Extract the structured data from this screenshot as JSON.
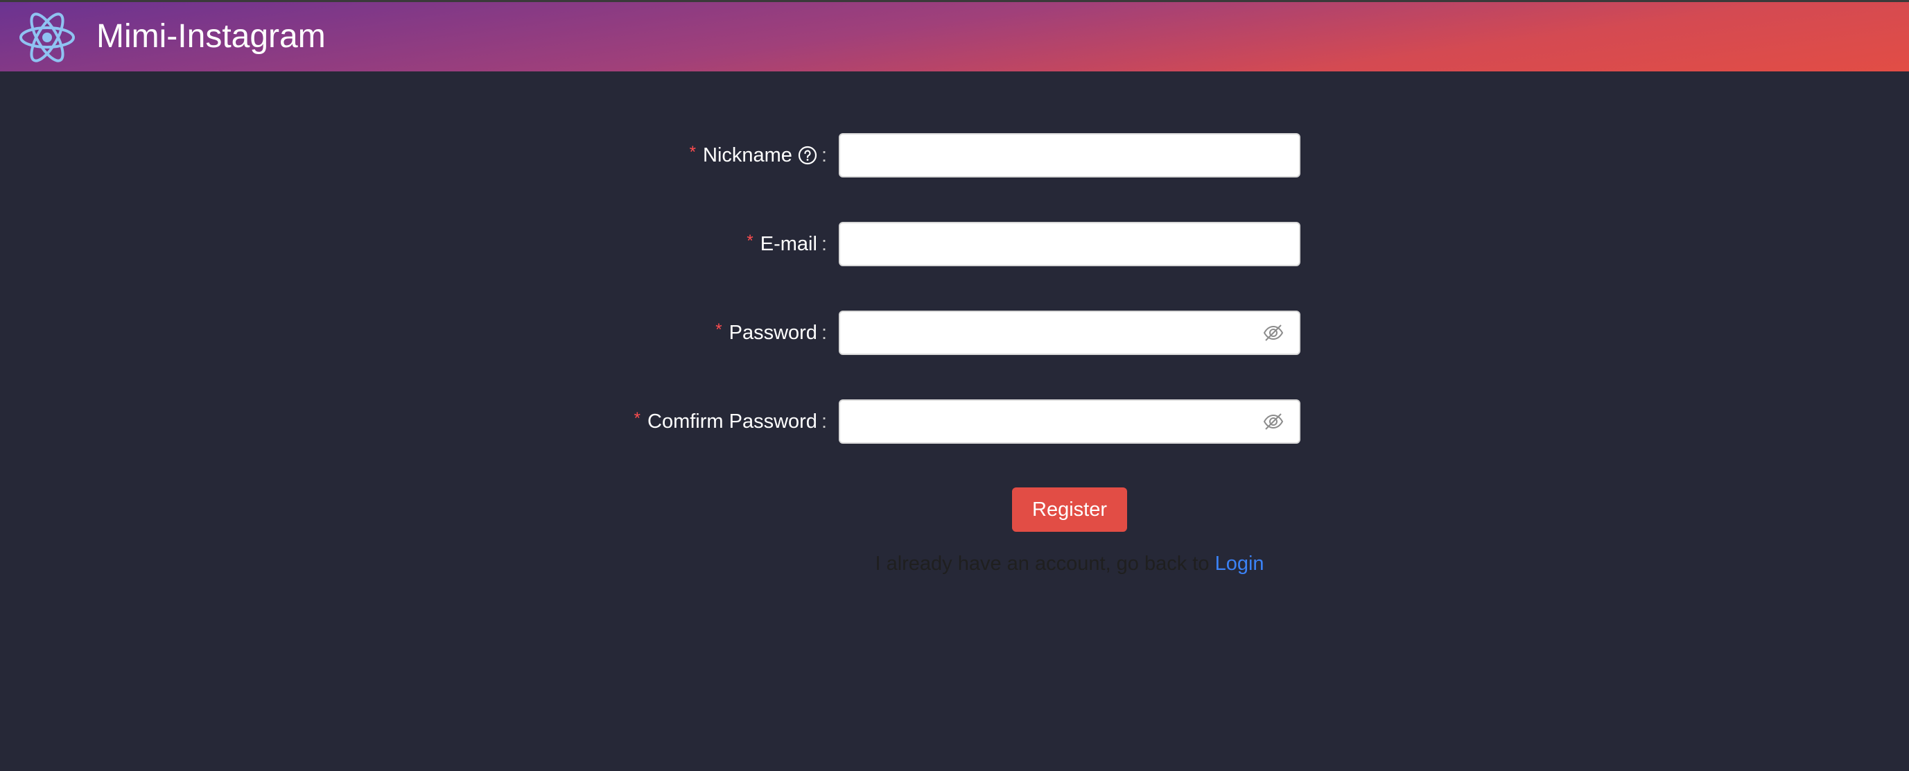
{
  "header": {
    "app_title": "Mimi-Instagram",
    "logo_icon": "atom-icon",
    "gradient_colors": [
      "#6b3391",
      "#e24d45"
    ]
  },
  "form": {
    "required_mark": "*",
    "colon": ":",
    "nickname": {
      "label": "Nickname",
      "help_icon": "question-circle-icon",
      "value": "",
      "placeholder": ""
    },
    "email": {
      "label": "E-mail",
      "value": "",
      "placeholder": ""
    },
    "password": {
      "label": "Password",
      "value": "",
      "placeholder": "",
      "toggle_icon": "eye-invisible-icon"
    },
    "confirm_password": {
      "label": "Comfirm Password",
      "value": "",
      "placeholder": "",
      "toggle_icon": "eye-invisible-icon"
    },
    "register_button": "Register",
    "login_prompt": "I already have an account, go back to",
    "login_link": "Login"
  },
  "colors": {
    "background": "#262837",
    "accent": "#e24d45",
    "link": "#3b82f6",
    "required": "#ff4d4f"
  }
}
